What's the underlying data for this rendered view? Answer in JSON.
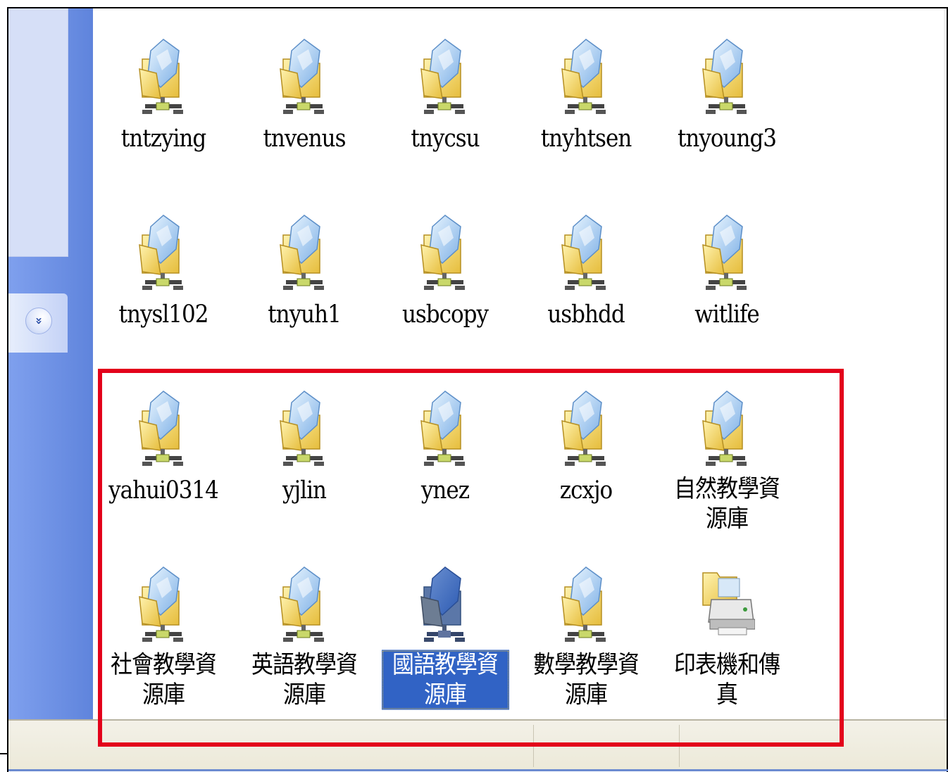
{
  "task_pane": {
    "expand_button_glyph": "»"
  },
  "icons": [
    {
      "label": "tntzying",
      "type": "share"
    },
    {
      "label": "tnvenus",
      "type": "share"
    },
    {
      "label": "tnycsu",
      "type": "share"
    },
    {
      "label": "tnyhtsen",
      "type": "share"
    },
    {
      "label": "tnyoung3",
      "type": "share"
    },
    {
      "label": "tnysl102",
      "type": "share"
    },
    {
      "label": "tnyuh1",
      "type": "share"
    },
    {
      "label": "usbcopy",
      "type": "share"
    },
    {
      "label": "usbhdd",
      "type": "share"
    },
    {
      "label": "witlife",
      "type": "share"
    },
    {
      "label": "yahui0314",
      "type": "share"
    },
    {
      "label": "yjlin",
      "type": "share"
    },
    {
      "label": "ynez",
      "type": "share"
    },
    {
      "label": "zcxjo",
      "type": "share"
    },
    {
      "label": "自然教學資源庫",
      "type": "share"
    },
    {
      "label": "社會教學資源庫",
      "type": "share"
    },
    {
      "label": "英語教學資源庫",
      "type": "share"
    },
    {
      "label": "國語教學資源庫",
      "type": "share",
      "selected": true
    },
    {
      "label": "數學教學資源庫",
      "type": "share"
    },
    {
      "label": "印表機和傳真",
      "type": "printer"
    }
  ],
  "colors": {
    "task_pane": "#6b8ee0",
    "selection": "#3163c5",
    "highlight_box": "#e3001b"
  }
}
